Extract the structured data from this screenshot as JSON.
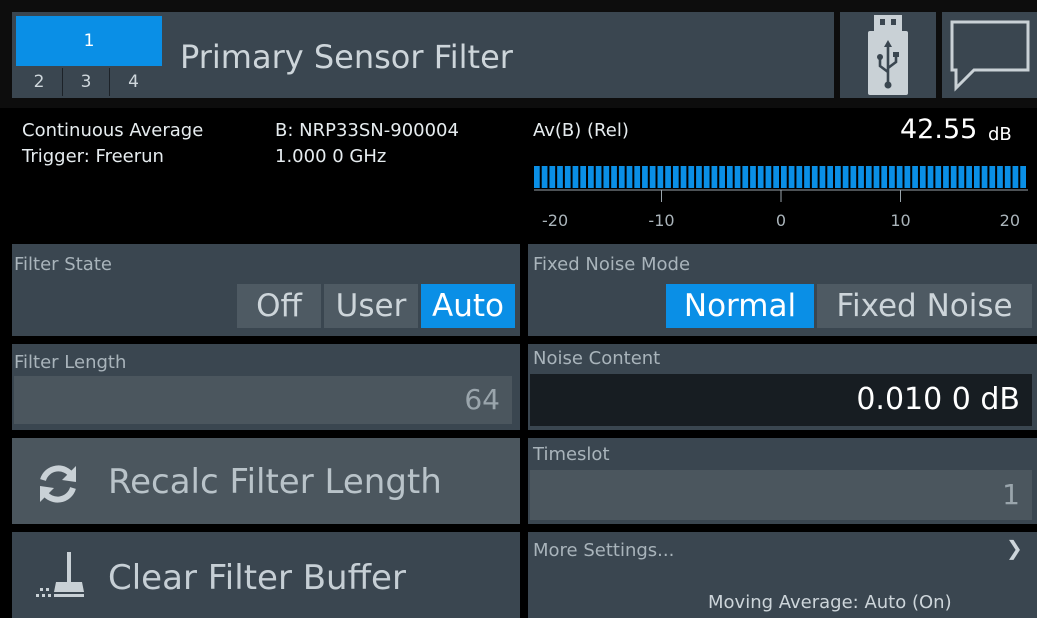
{
  "tabs": {
    "active": "1",
    "others": [
      "2",
      "3",
      "4"
    ]
  },
  "header": {
    "title": "Primary Sensor Filter",
    "icons": [
      "usb-icon",
      "message-icon"
    ]
  },
  "measurement": {
    "mode": "Continuous Average",
    "trigger": "Trigger: Freerun",
    "sensor": "B: NRP33SN-900004",
    "frequency": "1.000 0 GHz",
    "function": "Av(B) (Rel)",
    "value": "42.55",
    "unit": "dB",
    "scale": {
      "ticks": [
        "-20",
        "-10",
        "0",
        "10",
        "20"
      ],
      "min": -20,
      "max": 20
    },
    "bar_fill": 1.0,
    "bar_color": "#0a8fe6"
  },
  "filter_state": {
    "label": "Filter State",
    "options": [
      "Off",
      "User",
      "Auto"
    ],
    "selected": "Auto"
  },
  "noise_mode": {
    "label": "Fixed Noise Mode",
    "options": [
      "Normal",
      "Fixed Noise"
    ],
    "selected": "Normal"
  },
  "filter_length": {
    "label": "Filter Length",
    "value": "64"
  },
  "noise_content": {
    "label": "Noise Content",
    "value": "0.010 0  dB"
  },
  "recalc": {
    "label": "Recalc Filter Length",
    "icon": "refresh-icon"
  },
  "timeslot": {
    "label": "Timeslot",
    "value": "1"
  },
  "clear": {
    "label": "Clear Filter Buffer",
    "icon": "broom-icon"
  },
  "more": {
    "label": "More Settings...",
    "status": "Moving Average: Auto (On)",
    "icon": "chevron-right-icon"
  },
  "colors": {
    "accent": "#0a8fe6",
    "panel": "#3a4650",
    "background": "#000000"
  }
}
